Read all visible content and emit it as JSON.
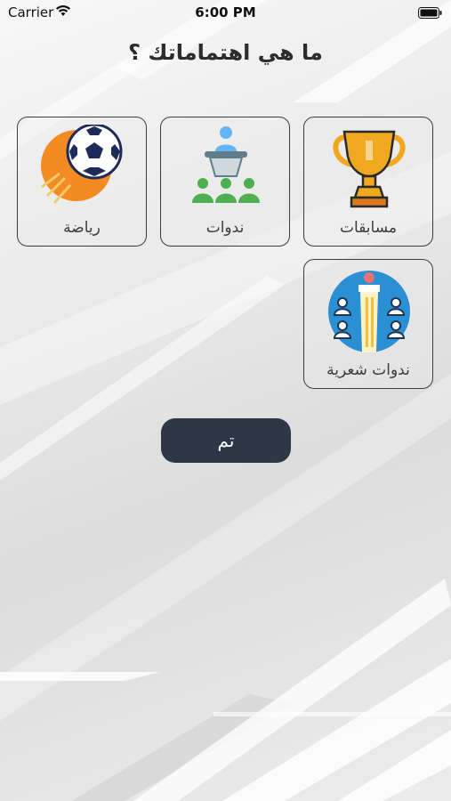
{
  "status_bar": {
    "carrier": "Carrier",
    "time": "6:00 PM",
    "wifi_icon": "wifi-icon",
    "battery_icon": "battery-icon"
  },
  "title": "ما هي اهتماماتك ؟",
  "interests": [
    {
      "label": "مسابقات",
      "icon": "trophy-icon"
    },
    {
      "label": "ندوات",
      "icon": "seminar-icon"
    },
    {
      "label": "رياضة",
      "icon": "soccer-ball-icon"
    },
    {
      "label": "ندوات شعرية",
      "icon": "poetry-reading-icon"
    }
  ],
  "done_button": {
    "label": "تم"
  },
  "colors": {
    "button_bg": "#2e3746",
    "card_border": "#3d3d3d",
    "trophy_gold": "#f0a81e",
    "seminar_green": "#4caf50",
    "seminar_blue": "#64b5f6",
    "ball_orange": "#f28c22",
    "poetry_blue": "#2b8fd3"
  }
}
